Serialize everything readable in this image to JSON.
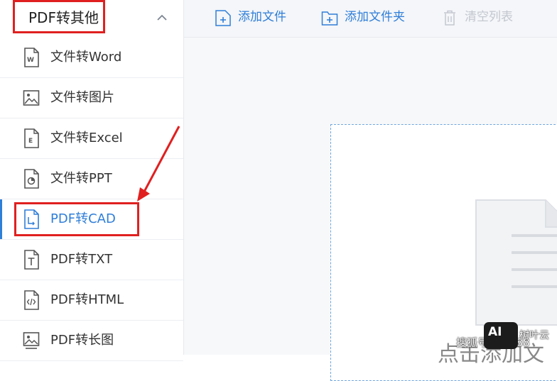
{
  "sidebar": {
    "title": "PDF转其他",
    "items": [
      {
        "label": "文件转Word",
        "icon": "word-file-icon"
      },
      {
        "label": "文件转图片",
        "icon": "image-file-icon"
      },
      {
        "label": "文件转Excel",
        "icon": "excel-file-icon"
      },
      {
        "label": "文件转PPT",
        "icon": "ppt-file-icon"
      },
      {
        "label": "PDF转CAD",
        "icon": "cad-file-icon",
        "active": true
      },
      {
        "label": "PDF转TXT",
        "icon": "txt-file-icon"
      },
      {
        "label": "PDF转HTML",
        "icon": "html-file-icon"
      },
      {
        "label": "PDF转长图",
        "icon": "long-image-icon"
      }
    ]
  },
  "toolbar": {
    "add_file": "添加文件",
    "add_folder": "添加文件夹",
    "clear_list": "清空列表"
  },
  "main": {
    "drop_hint": "点击添加文"
  },
  "watermark": {
    "text": "搜狐号@梦888",
    "logo": "AI",
    "brand": "树叶云"
  },
  "colors": {
    "accent": "#2f7ed8",
    "annotation": "#e02020",
    "disabled": "#c3c7cf"
  }
}
